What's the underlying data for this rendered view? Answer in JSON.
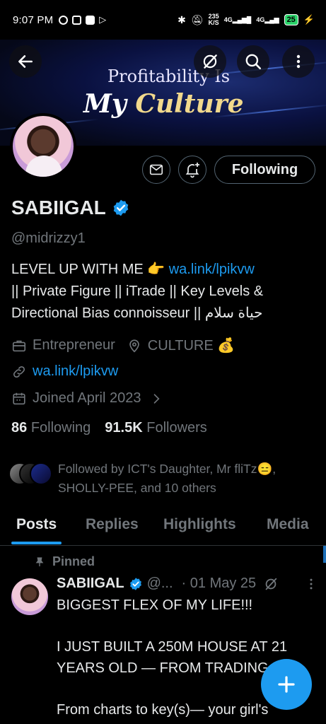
{
  "status_bar": {
    "time": "9:07 PM",
    "net_speed": "235",
    "net_unit": "K/S",
    "signal1": "4G",
    "signal2": "4G",
    "battery": "25"
  },
  "banner": {
    "line1": "Profitability Is",
    "line2_a": "My ",
    "line2_b": "Culture"
  },
  "profile": {
    "name": "SABIIGAL",
    "handle": "@midrizzy1",
    "bio_line1_text": "LEVEL UP WITH ME 👉 ",
    "bio_link": "wa.link/lpikvw",
    "bio_rest": "|| Private Figure || iTrade || Key Levels & Directional Bias connoisseur || حياة سلام",
    "occupation": "Entrepreneur",
    "location": "CULTURE 💰",
    "website": "wa.link/lpikvw",
    "joined": "Joined April 2023",
    "following_count": "86",
    "following_label": "Following",
    "followers_count": "91.5K",
    "followers_label": "Followers",
    "followed_by": "Followed by ICT's Daughter, Mr fliTz😑, SHOLLY-PEE, and 10 others"
  },
  "actions": {
    "following_button": "Following"
  },
  "tabs": [
    "Posts",
    "Replies",
    "Highlights",
    "Media"
  ],
  "post": {
    "pinned_label": "Pinned",
    "name": "SABIIGAL",
    "handle": "@...",
    "date": "· 01 May 25",
    "text": "BIGGEST FLEX OF MY LIFE!!!\n\nI JUST BUILT A 250M HOUSE AT 21 YEARS OLD — FROM TRADING\n\nFrom charts to key(s)— your girl's"
  },
  "colors": {
    "accent": "#1d9bf0",
    "muted": "#71767b",
    "background": "#000000"
  }
}
